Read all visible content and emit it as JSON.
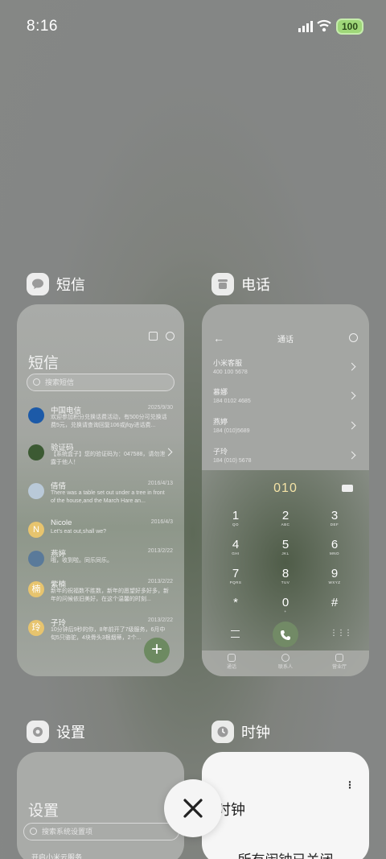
{
  "status": {
    "time": "8:16",
    "battery": "100"
  },
  "apps": {
    "sms": {
      "name": "短信",
      "title": "短信",
      "search_placeholder": "搜索短信",
      "messages": [
        {
          "name": "中国电信",
          "date": "2025/9/30",
          "text": "欢迎参加积分兑换话费活动，有500分可兑换话费5元，兑换请查询回复106或jfqy进话费..."
        },
        {
          "name": "验证码",
          "date": "",
          "text": "【系统盒子】您的验证码为：047588，请勿泄露于他人！"
        },
        {
          "name": "倩倩",
          "date": "2016/4/13",
          "text": "There was a table set out under a tree in front of the house,and the March Hare an..."
        },
        {
          "name": "Nicole",
          "date": "2016/4/3",
          "text": "Let's eat out,shall we?"
        },
        {
          "name": "燕婷",
          "date": "2013/2/22",
          "text": "哦，收到啦。同乐同乐。"
        },
        {
          "name": "紫楠",
          "date": "2013/2/22",
          "text": "新年的祝福数不胜数，新年的愿望好多好多，新年的问候依旧美好，在这个温馨的时刻..."
        },
        {
          "name": "子玲",
          "date": "2013/2/22",
          "text": "10分钟后9秒的你，8年前开了7级服务，6月中旬5只骆驼，4块骨头3根烟蒂，2个..."
        }
      ]
    },
    "phone": {
      "name": "电话",
      "title": "通话",
      "contacts": [
        {
          "name": "小米客服",
          "number": "400 100 5678"
        },
        {
          "name": "慕娜",
          "number": "184 0102 4685"
        },
        {
          "name": "燕婷",
          "number": "184 (010)5689"
        },
        {
          "name": "子玲",
          "number": "184 (010) 5678"
        }
      ],
      "dialed": "010",
      "keys": [
        {
          "d": "1",
          "l": "QO"
        },
        {
          "d": "2",
          "l": "ABC"
        },
        {
          "d": "3",
          "l": "DEF"
        },
        {
          "d": "4",
          "l": "GHI"
        },
        {
          "d": "5",
          "l": "JKL"
        },
        {
          "d": "6",
          "l": "MNO"
        },
        {
          "d": "7",
          "l": "PQRS"
        },
        {
          "d": "8",
          "l": "TUV"
        },
        {
          "d": "9",
          "l": "WXYZ"
        },
        {
          "d": "*",
          "l": ""
        },
        {
          "d": "0",
          "l": "+"
        },
        {
          "d": "#",
          "l": ""
        }
      ],
      "tabs": [
        "通话",
        "联系人",
        "营业厅"
      ]
    },
    "settings": {
      "name": "设置",
      "title": "设置",
      "search_placeholder": "搜索系统设置项",
      "first_row": "开启小米云服务"
    },
    "clock": {
      "name": "时钟",
      "title": "时钟",
      "status": "所有闹钟已关闭"
    }
  },
  "colors": {
    "accent_green": "#6d8a61",
    "battery": "#9fd779"
  }
}
